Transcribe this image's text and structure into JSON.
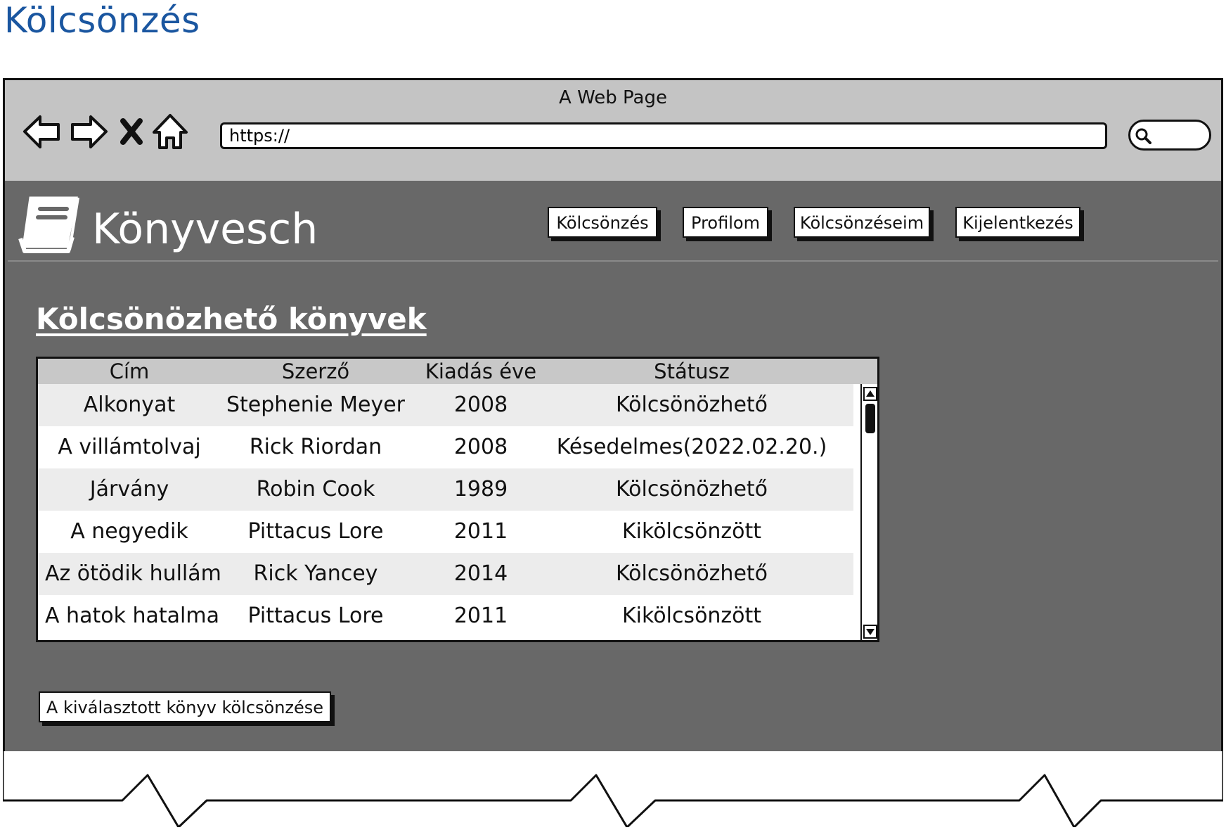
{
  "page_title": "Kölcsönzés",
  "browser": {
    "window_title": "A Web Page",
    "url": "https://"
  },
  "app": {
    "brand_name": "Könyvesch",
    "nav": [
      {
        "label": "Kölcsönzés"
      },
      {
        "label": "Profilom"
      },
      {
        "label": "Kölcsönzéseim"
      },
      {
        "label": "Kijelentkezés"
      }
    ]
  },
  "section": {
    "title": "Kölcsönözhető könyvek"
  },
  "table": {
    "headers": [
      "Cím",
      "Szerző",
      "Kiadás éve",
      "Státusz"
    ],
    "rows": [
      [
        "Alkonyat",
        "Stephenie Meyer",
        "2008",
        "Kölcsönözhető"
      ],
      [
        "A villámtolvaj",
        "Rick Riordan",
        "2008",
        "Késedelmes(2022.02.20.)"
      ],
      [
        "Járvány",
        "Robin Cook",
        "1989",
        "Kölcsönözhető"
      ],
      [
        "A negyedik",
        "Pittacus Lore",
        "2011",
        "Kikölcsönzött"
      ],
      [
        "Az ötödik hullám",
        "Rick Yancey",
        "2014",
        "Kölcsönözhető"
      ],
      [
        "A hatok hatalma",
        "Pittacus Lore",
        "2011",
        "Kikölcsönzött"
      ]
    ]
  },
  "action": {
    "borrow_label": "A kiválasztott könyv kölcsönzése"
  },
  "colors": {
    "page_title": "#1a56a0",
    "chrome_bg": "#c4c4c4",
    "content_bg": "#686868"
  }
}
